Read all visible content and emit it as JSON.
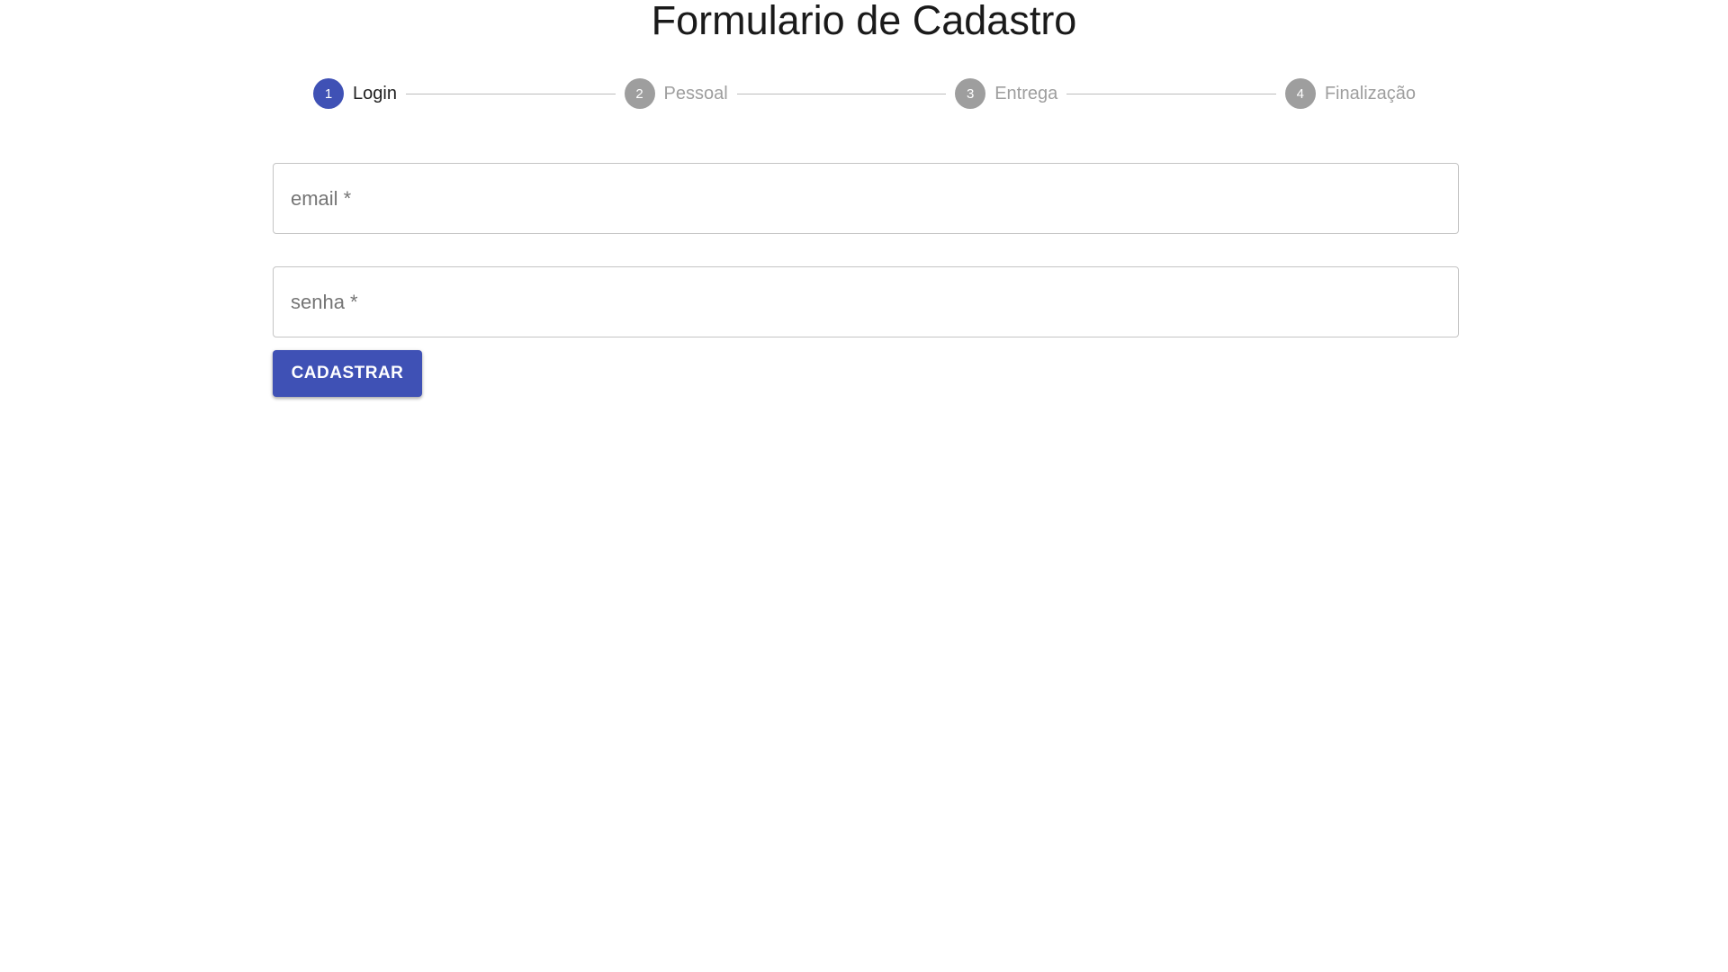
{
  "page": {
    "title": "Formulario de Cadastro"
  },
  "stepper": {
    "active_color": "#3f51b5",
    "inactive_color": "#9e9e9e",
    "steps": [
      {
        "number": "1",
        "label": "Login",
        "active": true
      },
      {
        "number": "2",
        "label": "Pessoal",
        "active": false
      },
      {
        "number": "3",
        "label": "Entrega",
        "active": false
      },
      {
        "number": "4",
        "label": "Finalização",
        "active": false
      }
    ]
  },
  "form": {
    "email": {
      "placeholder": "email *",
      "value": ""
    },
    "senha": {
      "placeholder": "senha *",
      "value": ""
    },
    "submit_label": "CADASTRAR",
    "submit_color": "#3f51b5"
  }
}
